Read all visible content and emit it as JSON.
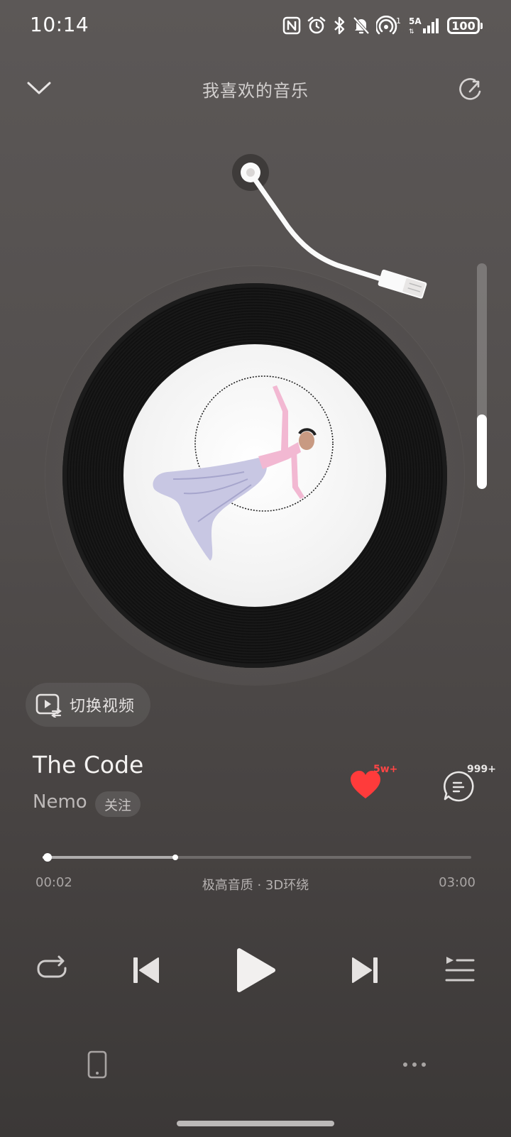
{
  "status_bar": {
    "time": "10:14",
    "network_label": "5A",
    "hotspot_count": "1",
    "battery": "100"
  },
  "header": {
    "title": "我喜欢的音乐",
    "collapse_icon": "chevron-down-icon",
    "share_icon": "share-icon"
  },
  "record": {
    "art_description_icon": "album-art-image"
  },
  "volume": {
    "level": 0.33
  },
  "video_switch": {
    "label": "切换视频"
  },
  "song": {
    "title": "The Code",
    "artist": "Nemo",
    "follow_label": "关注"
  },
  "actions": {
    "like_count": "5w+",
    "comment_count": "999+",
    "like_color": "#ff3b3b"
  },
  "progress": {
    "current": "00:02",
    "total": "03:00",
    "played_fraction": 0.011,
    "buffered_fraction": 0.31,
    "quality": "极高音质 · 3D环绕"
  },
  "controls": {
    "repeat_icon": "repeat-icon",
    "previous_icon": "skip-previous-icon",
    "play_icon": "play-icon",
    "next_icon": "skip-next-icon",
    "playlist_icon": "playlist-icon"
  },
  "bottom": {
    "device_icon": "phone-device-icon",
    "more_icon": "more-icon"
  }
}
